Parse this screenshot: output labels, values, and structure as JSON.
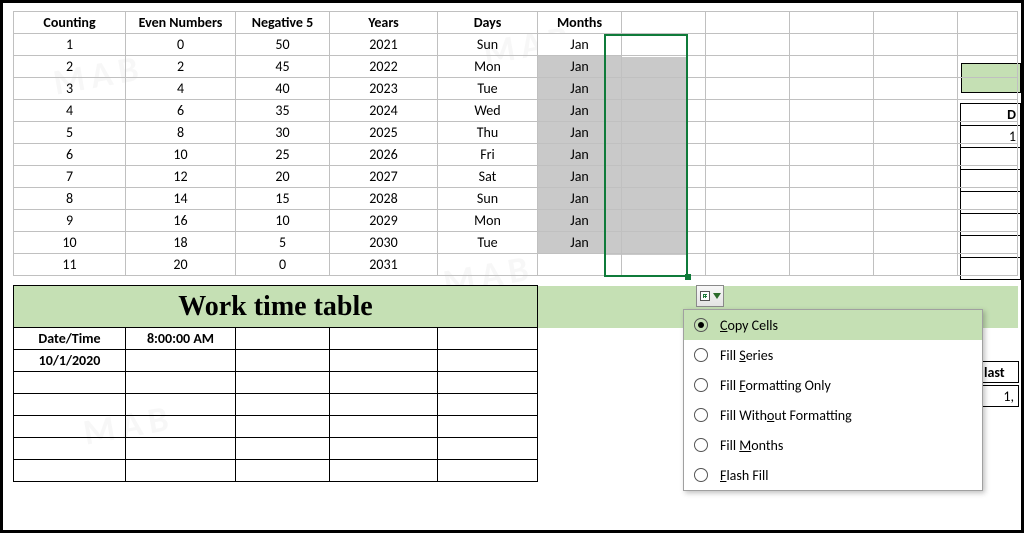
{
  "headers": {
    "a": "Counting",
    "b": "Even Numbers",
    "c": "Negative 5",
    "d": "Years",
    "e": "Days",
    "f": "Months"
  },
  "rows": [
    {
      "a": "1",
      "b": "0",
      "c": "50",
      "d": "2021",
      "e": "Sun",
      "f": "Jan"
    },
    {
      "a": "2",
      "b": "2",
      "c": "45",
      "d": "2022",
      "e": "Mon",
      "f": "Jan"
    },
    {
      "a": "3",
      "b": "4",
      "c": "40",
      "d": "2023",
      "e": "Tue",
      "f": "Jan"
    },
    {
      "a": "4",
      "b": "6",
      "c": "35",
      "d": "2024",
      "e": "Wed",
      "f": "Jan"
    },
    {
      "a": "5",
      "b": "8",
      "c": "30",
      "d": "2025",
      "e": "Thu",
      "f": "Jan"
    },
    {
      "a": "6",
      "b": "10",
      "c": "25",
      "d": "2026",
      "e": "Fri",
      "f": "Jan"
    },
    {
      "a": "7",
      "b": "12",
      "c": "20",
      "d": "2027",
      "e": "Sat",
      "f": "Jan"
    },
    {
      "a": "8",
      "b": "14",
      "c": "15",
      "d": "2028",
      "e": "Sun",
      "f": "Jan"
    },
    {
      "a": "9",
      "b": "16",
      "c": "10",
      "d": "2029",
      "e": "Mon",
      "f": "Jan"
    },
    {
      "a": "10",
      "b": "18",
      "c": "5",
      "d": "2030",
      "e": "Tue",
      "f": "Jan"
    },
    {
      "a": "11",
      "b": "20",
      "c": "0",
      "d": "2031",
      "e": "",
      "f": ""
    }
  ],
  "work_table": {
    "title": "Work time table",
    "date_label": "Date/Time",
    "time_label": "8:00:00 AM",
    "date_value": "10/1/2020"
  },
  "menu": {
    "items": [
      {
        "label": "Copy Cells",
        "underline": 0,
        "selected": true
      },
      {
        "label": "Fill Series",
        "underline": 5,
        "selected": false
      },
      {
        "label": "Fill Formatting Only",
        "underline": 5,
        "selected": false
      },
      {
        "label": "Fill Without Formatting",
        "underline": 4,
        "selected": false
      },
      {
        "label": "Fill Months",
        "underline": 5,
        "selected": false
      },
      {
        "label": "Flash Fill",
        "underline": 0,
        "selected": false
      }
    ]
  },
  "right": {
    "col_head": "D",
    "row1": "1",
    "last_label": "last",
    "last_val": "1,"
  },
  "watermark": "MAB"
}
